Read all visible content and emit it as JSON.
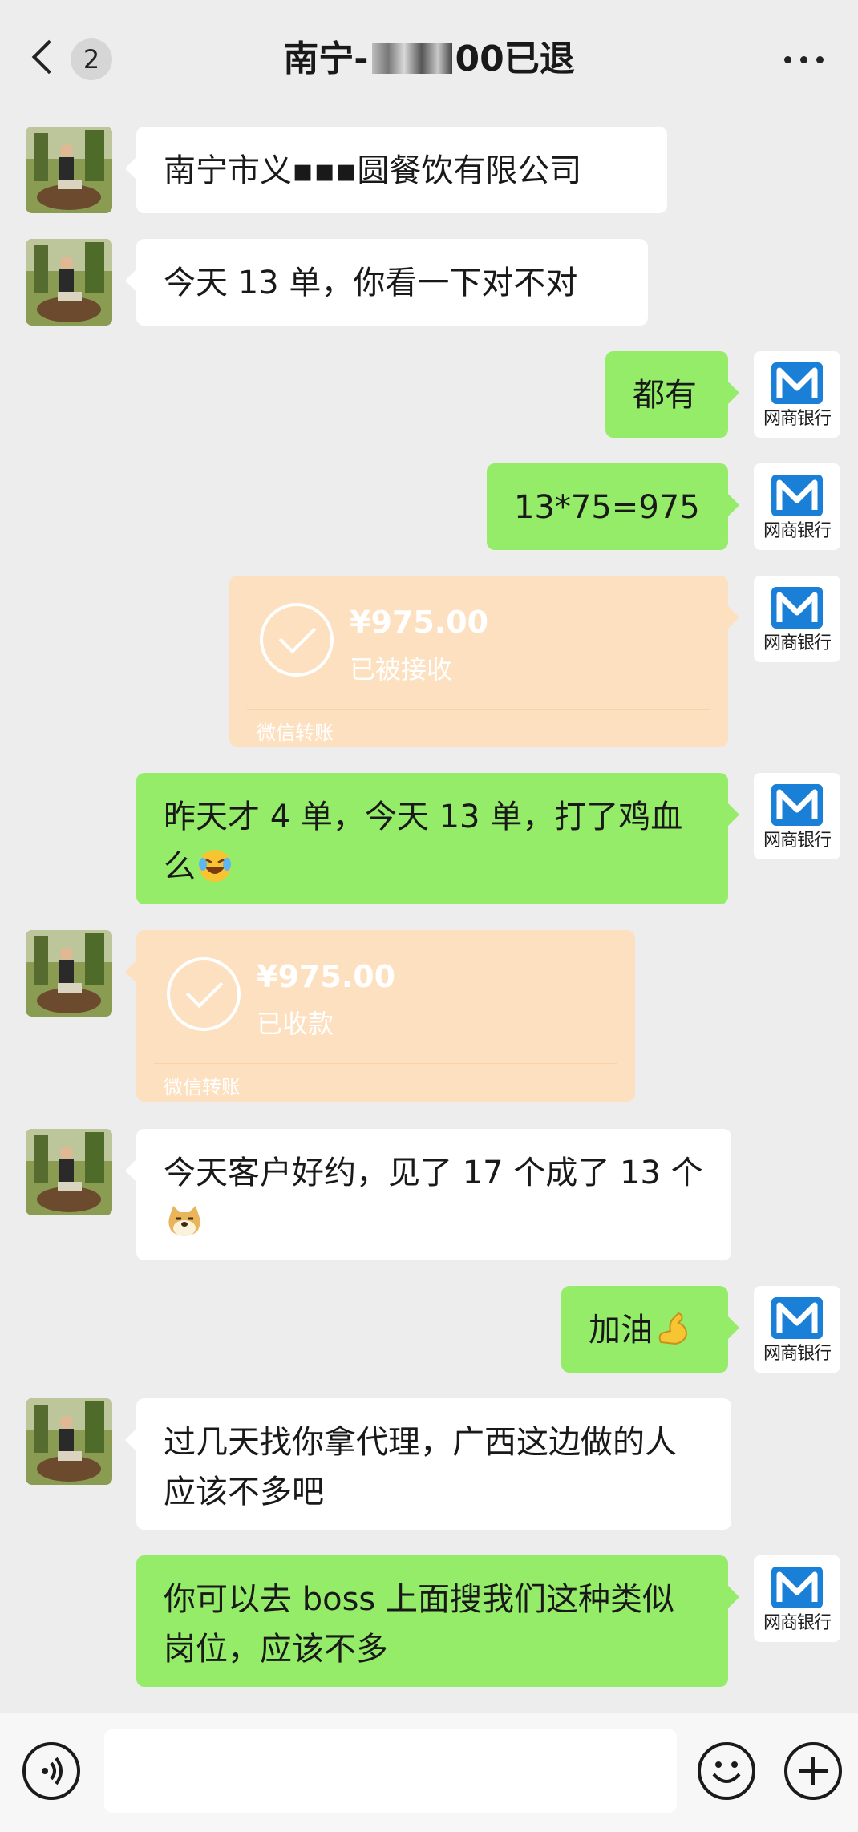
{
  "header": {
    "unread_count": "2",
    "title_prefix": "南宁-",
    "title_suffix": "00已退"
  },
  "messages": {
    "m1": "南宁市义▪▪▪圆餐饮有限公司",
    "m2": "今天 13 单，你看一下对不对",
    "m3": "都有",
    "m4": "13*75=975",
    "m6_text": "昨天才 4 单，今天 13 单，打了鸡血么",
    "m8_text": "今天客户好约，见了 17 个成了 13 个",
    "m9_text": "加油",
    "m10": "过几天找你拿代理，广西这边做的人应该不多吧",
    "m11": "你可以去 boss 上面搜我们这种类似岗位，应该不多"
  },
  "transfer_out": {
    "amount": "¥975.00",
    "status": "已被接收",
    "label": "微信转账"
  },
  "transfer_in": {
    "amount": "¥975.00",
    "status": "已收款",
    "label": "微信转账"
  },
  "bank_avatar": {
    "name": "网商银行"
  },
  "colors": {
    "out_bubble": "#95ec69",
    "in_bubble": "#ffffff",
    "transfer": "#fde0bf",
    "background": "#ededed"
  }
}
